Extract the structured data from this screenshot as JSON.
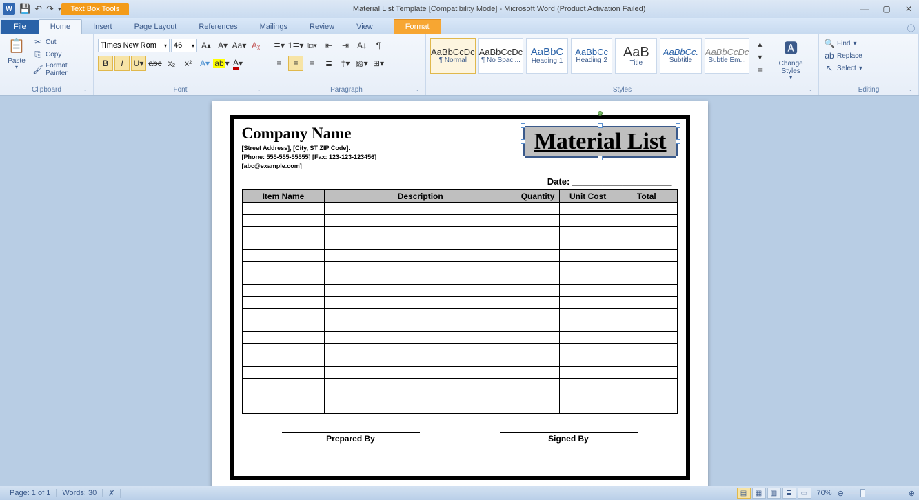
{
  "titlebar": {
    "context_tab_group": "Text Box Tools",
    "title": "Material List Template [Compatibility Mode]  -  Microsoft Word (Product Activation Failed)"
  },
  "tabs": {
    "file": "File",
    "items": [
      "Home",
      "Insert",
      "Page Layout",
      "References",
      "Mailings",
      "Review",
      "View"
    ],
    "context": "Format",
    "active": "Home"
  },
  "ribbon": {
    "clipboard": {
      "label": "Clipboard",
      "paste": "Paste",
      "cut": "Cut",
      "copy": "Copy",
      "fmtpainter": "Format Painter"
    },
    "font": {
      "label": "Font",
      "name": "Times New Rom",
      "size": "46"
    },
    "paragraph": {
      "label": "Paragraph"
    },
    "styles": {
      "label": "Styles",
      "list": [
        {
          "preview": "AaBbCcDc",
          "name": "¶ Normal",
          "sel": true
        },
        {
          "preview": "AaBbCcDc",
          "name": "¶ No Spaci..."
        },
        {
          "preview": "AaBbC",
          "name": "Heading 1"
        },
        {
          "preview": "AaBbCc",
          "name": "Heading 2"
        },
        {
          "preview": "AaB",
          "name": "Title"
        },
        {
          "preview": "AaBbCc.",
          "name": "Subtitle"
        },
        {
          "preview": "AaBbCcDc",
          "name": "Subtle Em..."
        }
      ],
      "change": "Change Styles"
    },
    "editing": {
      "label": "Editing",
      "find": "Find",
      "replace": "Replace",
      "select": "Select"
    }
  },
  "document": {
    "company_name": "Company Name",
    "address": "[Street Address], [City, ST ZIP Code].",
    "phonefax": "[Phone: 555-555-55555] [Fax: 123-123-123456]",
    "email": "[abc@example.com]",
    "textbox_title": "Material List",
    "date_label": "Date:",
    "date_line": " ____________________",
    "table_headers": [
      "Item Name",
      "Description",
      "Quantity",
      "Unit Cost",
      "Total"
    ],
    "row_count": 18,
    "prepared_by": "Prepared  By",
    "signed_by": "Signed By"
  },
  "statusbar": {
    "page": "Page: 1 of 1",
    "words": "Words: 30",
    "zoom": "70%"
  }
}
